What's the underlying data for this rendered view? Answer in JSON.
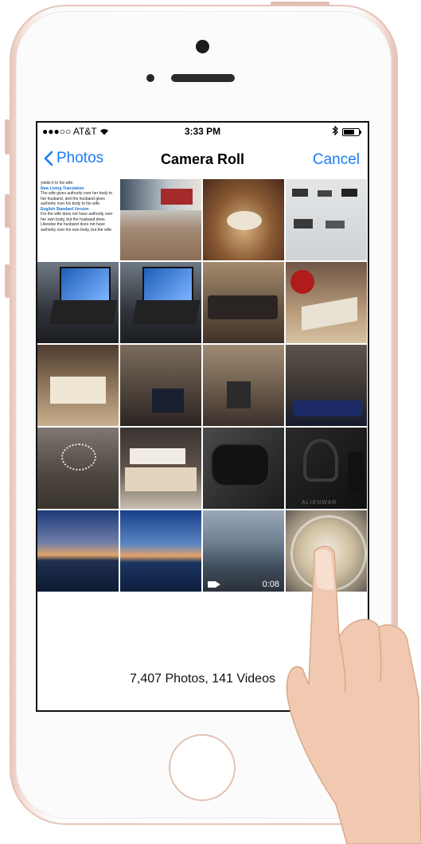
{
  "status_bar": {
    "carrier": "●●●○○ AT&T",
    "time": "3:33 PM",
    "battery_level": 0.7
  },
  "nav": {
    "back_label": "Photos",
    "title": "Camera Roll",
    "cancel_label": "Cancel"
  },
  "grid": {
    "text_thumb": {
      "line0": "yields it to his wife.",
      "heading1": "New Living Translation",
      "body1": "The wife gives authority over her body to her husband, and the husband gives authority over his body to his wife.",
      "heading2": "English Standard Version",
      "body2": "For the wife does not have authority over her own body, but the husband does. Likewise the husband does not have authority over his own body, but the wife."
    },
    "video_duration": "0:08",
    "hmd_box_text": "ALIENWAR"
  },
  "footer": {
    "summary": "7,407 Photos, 141 Videos"
  },
  "colors": {
    "ios_blue": "#1a7cf5",
    "phone_rose_gold": "#e5c4b9"
  }
}
